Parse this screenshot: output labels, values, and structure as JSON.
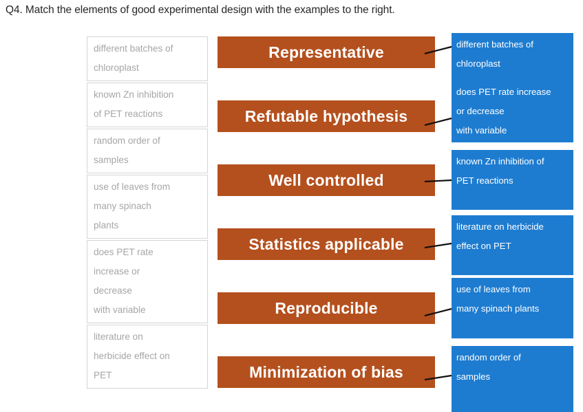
{
  "question": {
    "label": "Q4. Match the elements of good experimental design with the examples to the right."
  },
  "colors": {
    "orange": "#b4501e",
    "blue": "#1e7cd0",
    "term_border": "#d4d4d4",
    "term_text": "#a6a6a6",
    "connector": "#000000",
    "title_text": "#262626",
    "page_background": "#ffffff"
  },
  "left_column": {
    "name": "term-bank",
    "items": [
      {
        "lines": [
          "different batches of",
          "chloroplast"
        ]
      },
      {
        "lines": [
          "known Zn inhibition",
          "of PET reactions"
        ]
      },
      {
        "lines": [
          "random order of",
          "samples"
        ]
      },
      {
        "lines": [
          "use of leaves from",
          "many spinach",
          "plants"
        ]
      },
      {
        "lines": [
          "does PET rate",
          "increase or",
          "decrease",
          "with variable"
        ]
      },
      {
        "lines": [
          "literature on",
          "herbicide effect on",
          "PET"
        ]
      }
    ]
  },
  "middle_column": {
    "name": "design-elements",
    "items": [
      {
        "label": "Representative"
      },
      {
        "label": "Refutable hypothesis"
      },
      {
        "label": "Well controlled"
      },
      {
        "label": "Statistics applicable"
      },
      {
        "label": "Reproducible"
      },
      {
        "label": "Minimization of bias"
      }
    ]
  },
  "right_column": {
    "name": "example-answers",
    "items": [
      {
        "lines": [
          "different batches of",
          "chloroplast",
          "",
          "does PET rate increase",
          "or decrease",
          "with variable"
        ]
      },
      {
        "lines": [
          "known Zn inhibition of",
          "PET reactions"
        ]
      },
      {
        "lines": [
          "literature on herbicide",
          "effect on PET"
        ]
      },
      {
        "lines": [
          "use of leaves from",
          "many spinach plants"
        ]
      },
      {
        "lines": [
          "random order of",
          "samples"
        ]
      }
    ]
  },
  "connectors": [
    {
      "from": "Representative",
      "to": "different batches of chloroplast"
    },
    {
      "from": "Refutable hypothesis",
      "to": "does PET rate increase or decrease with variable"
    },
    {
      "from": "Well controlled",
      "to": "known Zn inhibition of PET reactions"
    },
    {
      "from": "Statistics applicable",
      "to": "literature on herbicide effect on PET"
    },
    {
      "from": "Reproducible",
      "to": "use of leaves from many spinach plants"
    },
    {
      "from": "Minimization of bias",
      "to": "random order of samples"
    }
  ]
}
